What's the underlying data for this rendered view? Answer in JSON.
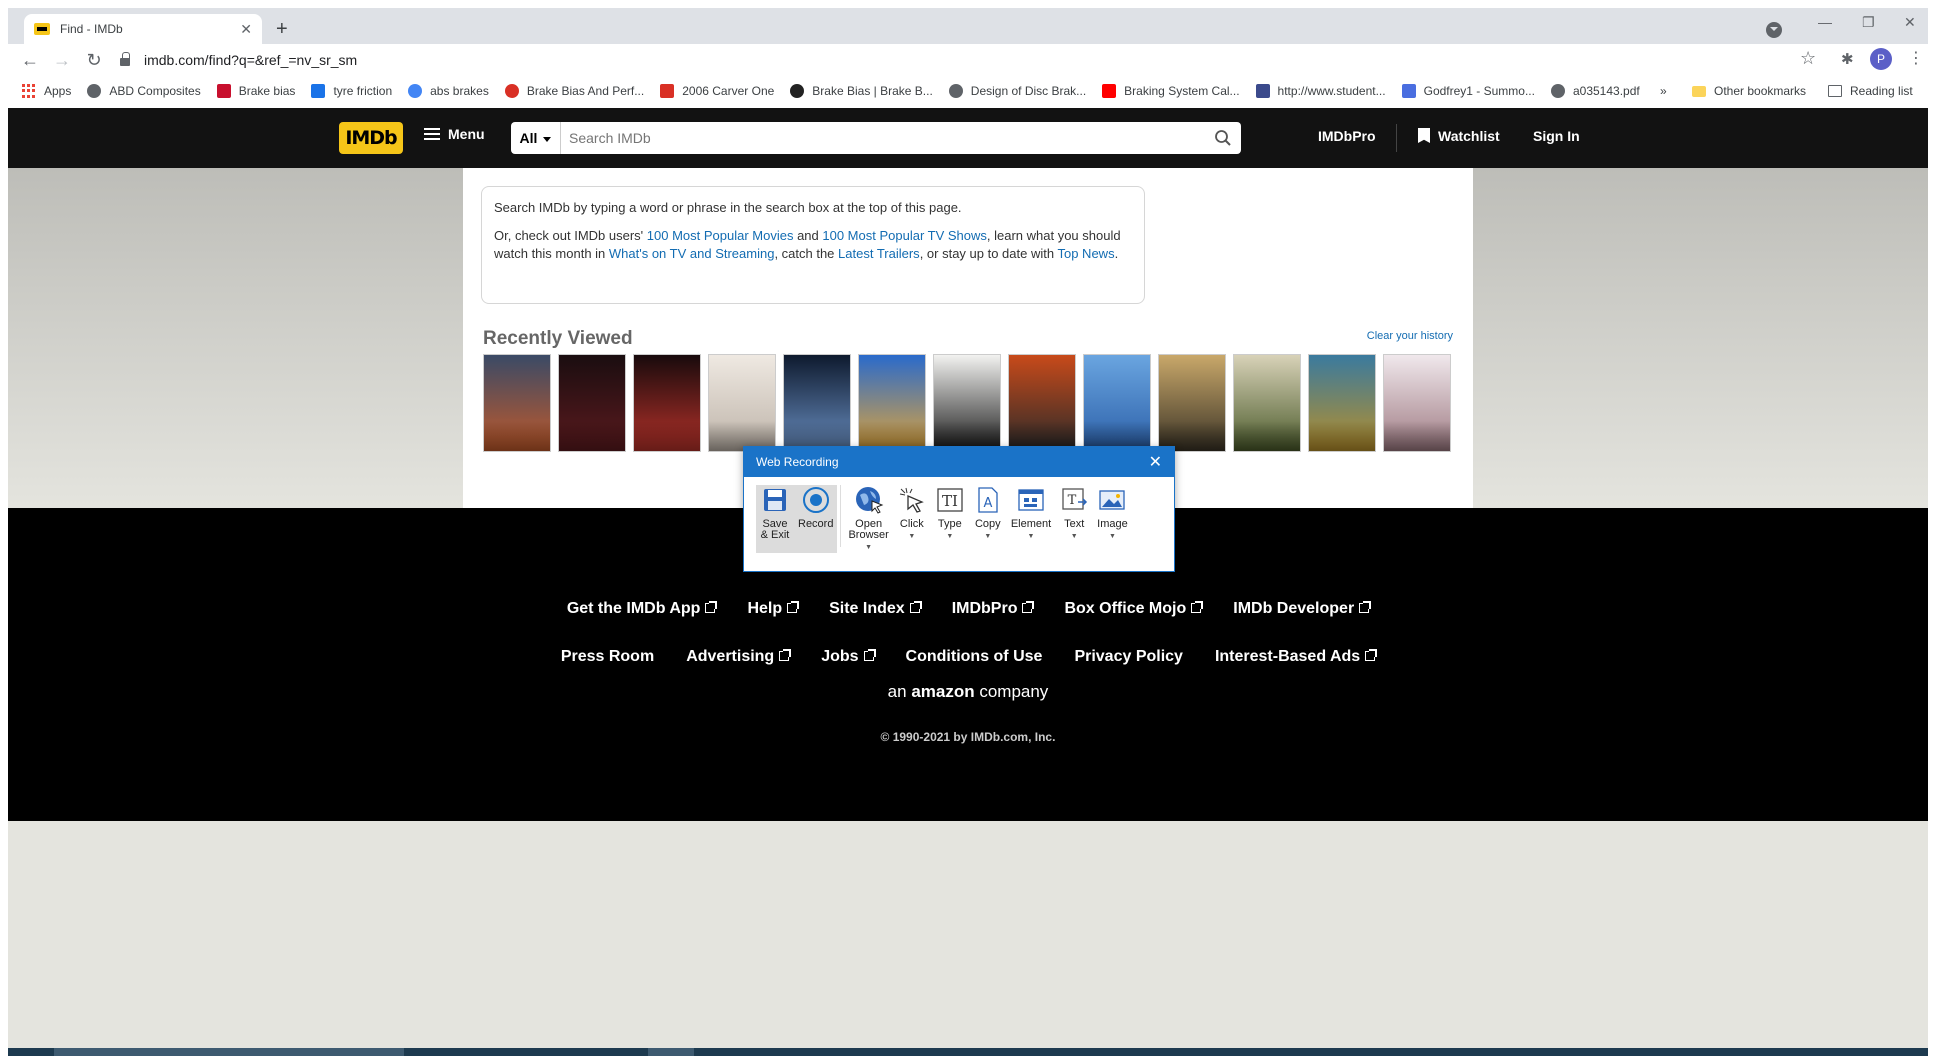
{
  "browser": {
    "tab_title": "Find - IMDb",
    "url": "imdb.com/find?q=&ref_=nv_sr_sm",
    "profile_initial": "P",
    "bookmarks": [
      {
        "label": "Apps",
        "icon": "apps-grid-icon"
      },
      {
        "label": "ABD Composites",
        "icon": "globe-icon"
      },
      {
        "label": "Brake bias",
        "icon": "fr-logo-icon"
      },
      {
        "label": "tyre friction",
        "icon": "m-logo-icon"
      },
      {
        "label": "abs brakes",
        "icon": "google-icon"
      },
      {
        "label": "Brake Bias And Perf...",
        "icon": "target-icon"
      },
      {
        "label": "2006 Carver One",
        "icon": "pdf-icon"
      },
      {
        "label": "Brake Bias | Brake B...",
        "icon": "record-icon"
      },
      {
        "label": "Design of Disc Brak...",
        "icon": "globe-icon"
      },
      {
        "label": "Braking System Cal...",
        "icon": "youtube-icon"
      },
      {
        "label": "http://www.student...",
        "icon": "shield-icon"
      },
      {
        "label": "Godfrey1 - Summo...",
        "icon": "doc-icon"
      },
      {
        "label": "a035143.pdf",
        "icon": "globe-icon"
      }
    ],
    "overflow_label": "»",
    "other_bookmarks": "Other bookmarks",
    "reading_list": "Reading list"
  },
  "imdb": {
    "logo": "IMDb",
    "menu_label": "Menu",
    "search_category": "All",
    "search_placeholder": "Search IMDb",
    "search_value": "",
    "imdbpro": "IMDbPro",
    "watchlist": "Watchlist",
    "signin": "Sign In",
    "info": {
      "line1": "Search IMDb by typing a word or phrase in the search box at the top of this page.",
      "p2_a": "Or, check out IMDb users' ",
      "link_movies": "100 Most Popular Movies",
      "p2_b": " and ",
      "link_tv": "100 Most Popular TV Shows",
      "p2_c": ", learn what you should watch this month in ",
      "link_streaming": "What's on TV and Streaming",
      "p2_d": ", catch the ",
      "link_trailers": "Latest Trailers",
      "p2_e": ", or stay up to date with ",
      "link_news": "Top News",
      "p2_f": "."
    },
    "recently_viewed_title": "Recently Viewed",
    "clear_history": "Clear your history",
    "posters": [
      {
        "color_top": "#3a4a66",
        "color_bottom": "#c25a2a"
      },
      {
        "color_top": "#1a0d10",
        "color_bottom": "#5c1a1e"
      },
      {
        "color_top": "#180a0c",
        "color_bottom": "#b8322a"
      },
      {
        "color_top": "#efe9e2",
        "color_bottom": "#bdb3a8"
      },
      {
        "color_top": "#0e1a2e",
        "color_bottom": "#6a8fc2"
      },
      {
        "color_top": "#2a6acb",
        "color_bottom": "#e0a53a"
      },
      {
        "color_top": "#f2f2f0",
        "color_bottom": "#1a1a1a"
      },
      {
        "color_top": "#c84a1a",
        "color_bottom": "#2a2a2a"
      },
      {
        "color_top": "#6aa5e0",
        "color_bottom": "#2b5fa8"
      },
      {
        "color_top": "#c9a86a",
        "color_bottom": "#3a3326"
      },
      {
        "color_top": "#d8d2b8",
        "color_bottom": "#4a5a2a"
      },
      {
        "color_top": "#3a7a9e",
        "color_bottom": "#b8902a"
      },
      {
        "color_top": "#f0e8ec",
        "color_bottom": "#9e7a82"
      }
    ],
    "footer_row1": [
      {
        "label": "Get the IMDb App",
        "external": true
      },
      {
        "label": "Help",
        "external": true
      },
      {
        "label": "Site Index",
        "external": true
      },
      {
        "label": "IMDbPro",
        "external": true
      },
      {
        "label": "Box Office Mojo",
        "external": true
      },
      {
        "label": "IMDb Developer",
        "external": true
      }
    ],
    "footer_row2": [
      {
        "label": "Press Room",
        "external": false
      },
      {
        "label": "Advertising",
        "external": true
      },
      {
        "label": "Jobs",
        "external": true
      },
      {
        "label": "Conditions of Use",
        "external": false
      },
      {
        "label": "Privacy Policy",
        "external": false
      },
      {
        "label": "Interest-Based Ads",
        "external": true
      }
    ],
    "amazon_an": "an ",
    "amazon_word": "amazon",
    "amazon_company": " company",
    "copyright": "© 1990-2021 by IMDb.com, Inc."
  },
  "recorder": {
    "title": "Web Recording",
    "tools": [
      {
        "label": "Save\n& Exit",
        "name": "save-exit-button",
        "icon": "save-icon",
        "dropdown": false,
        "active": true
      },
      {
        "label": "Record",
        "name": "record-button",
        "icon": "record-icon",
        "dropdown": false,
        "active": true
      },
      {
        "label": "Open\nBrowser",
        "name": "open-browser-button",
        "icon": "globe-cursor-icon",
        "dropdown": true,
        "active": false
      },
      {
        "label": "Click",
        "name": "click-button",
        "icon": "click-icon",
        "dropdown": true,
        "active": false
      },
      {
        "label": "Type",
        "name": "type-button",
        "icon": "type-icon",
        "dropdown": true,
        "active": false
      },
      {
        "label": "Copy",
        "name": "copy-button",
        "icon": "copy-icon",
        "dropdown": true,
        "active": false
      },
      {
        "label": "Element",
        "name": "element-button",
        "icon": "element-icon",
        "dropdown": true,
        "active": false
      },
      {
        "label": "Text",
        "name": "text-button",
        "icon": "text-icon",
        "dropdown": true,
        "active": false
      },
      {
        "label": "Image",
        "name": "image-button",
        "icon": "image-icon",
        "dropdown": true,
        "active": false
      }
    ]
  },
  "colors": {
    "imdb_yellow": "#f5c518",
    "link_blue": "#136cb2",
    "recorder_blue": "#1a73c8"
  }
}
